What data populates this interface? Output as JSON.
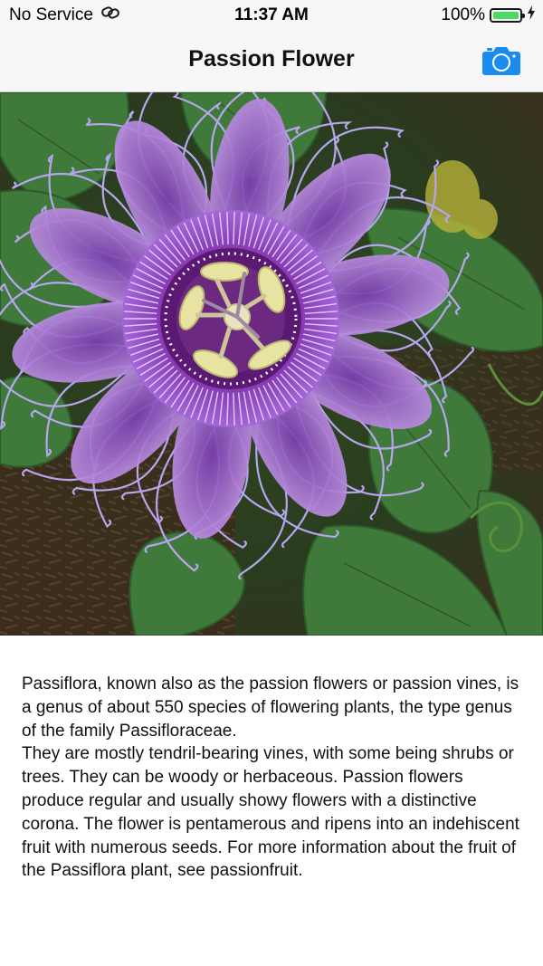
{
  "status_bar": {
    "carrier": "No Service",
    "time": "11:37 AM",
    "battery_percent": "100%",
    "battery_level": 1.0,
    "battery_color": "#4cd964",
    "icons": [
      "wifi-link-icon",
      "battery-icon",
      "charging-bolt-icon"
    ]
  },
  "nav": {
    "title": "Passion Flower",
    "camera_icon": "camera-icon",
    "accent_color": "#1a8cf0"
  },
  "photo": {
    "subject": "passion-flower-photo"
  },
  "description": {
    "text": "Passiflora, known also as the passion flowers or passion vines, is a genus of about 550 species of flowering plants, the type genus of the family Passifloraceae.\nThey are mostly tendril-bearing vines, with some being shrubs or trees. They can be woody or herbaceous. Passion flowers produce regular and usually showy flowers with a distinctive corona. The flower is pentamerous and ripens into an indehiscent fruit with numerous seeds. For more information about the fruit of the Passiflora plant, see passionfruit."
  }
}
